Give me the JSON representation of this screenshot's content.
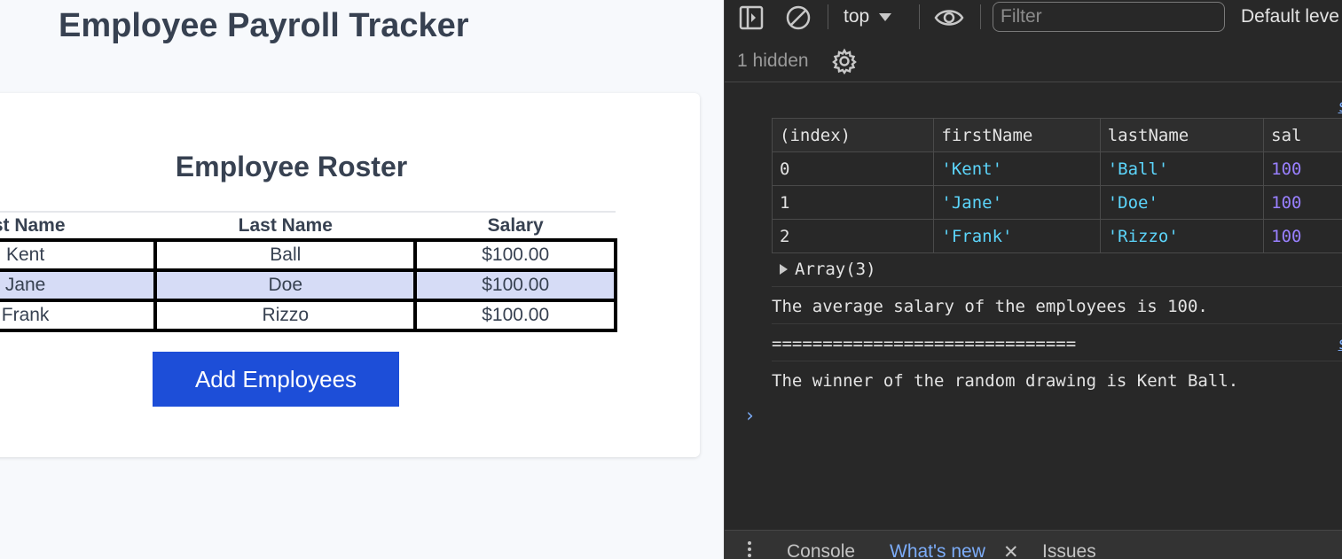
{
  "page": {
    "title": "Employee Payroll Tracker",
    "roster_title": "Employee Roster",
    "columns": [
      "rst Name",
      "Last Name",
      "Salary"
    ],
    "rows": [
      [
        "Kent",
        "Ball",
        "$100.00"
      ],
      [
        "Jane",
        "Doe",
        "$100.00"
      ],
      [
        "Frank",
        "Rizzo",
        "$100.00"
      ]
    ],
    "add_button": "Add Employees"
  },
  "devtools": {
    "context": "top",
    "filter_placeholder": "Filter",
    "levels_label": "Default leve",
    "hidden_count": "1 hidden",
    "source_link": "s",
    "table": {
      "headers": [
        "(index)",
        "firstName",
        "lastName",
        "sal"
      ],
      "rows": [
        [
          "0",
          "'Kent'",
          "'Ball'",
          "100"
        ],
        [
          "1",
          "'Jane'",
          "'Doe'",
          "100"
        ],
        [
          "2",
          "'Frank'",
          "'Rizzo'",
          "100"
        ]
      ]
    },
    "array_label": "Array(3)",
    "logs": {
      "average": "The average salary of the employees is 100.",
      "separator": "==============================",
      "winner": "The winner of the random drawing is Kent Ball."
    },
    "prompt": "›",
    "drawer_tabs": [
      "Console",
      "What's new",
      "Issues"
    ],
    "close_glyph": "✕",
    "colors": {
      "string": "#5cd5fb",
      "number": "#9980ff",
      "link": "#7cacf8",
      "button": "#1d4ed8"
    }
  }
}
